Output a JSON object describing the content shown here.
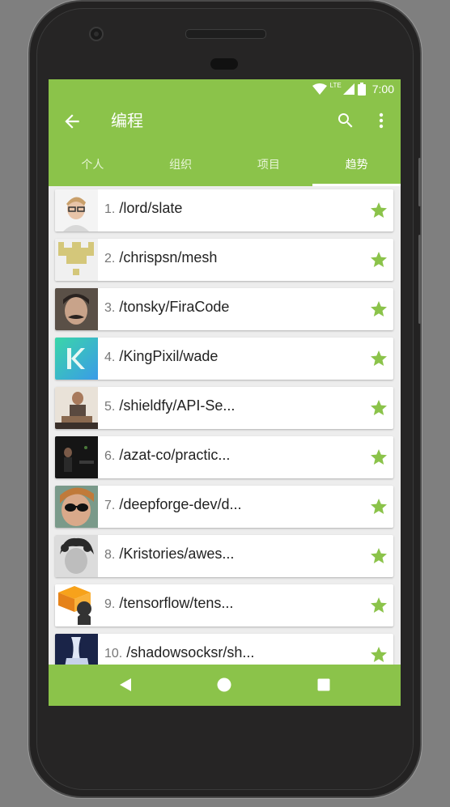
{
  "status_bar": {
    "time": "7:00",
    "network_label": "LTE"
  },
  "app_bar": {
    "title": "编程",
    "icons": [
      "back-arrow-icon",
      "search-icon",
      "more-vert-icon"
    ]
  },
  "tabs": [
    {
      "label": "个人",
      "active": false
    },
    {
      "label": "组织",
      "active": false
    },
    {
      "label": "项目",
      "active": false
    },
    {
      "label": "趋势",
      "active": true
    }
  ],
  "repos": [
    {
      "rank": "1.",
      "name": "/lord/slate"
    },
    {
      "rank": "2.",
      "name": "/chrispsn/mesh"
    },
    {
      "rank": "3.",
      "name": "/tonsky/FiraCode"
    },
    {
      "rank": "4.",
      "name": "/KingPixil/wade"
    },
    {
      "rank": "5.",
      "name": "/shieldfy/API-Se..."
    },
    {
      "rank": "6.",
      "name": "/azat-co/practic..."
    },
    {
      "rank": "7.",
      "name": "/deepforge-dev/d..."
    },
    {
      "rank": "8.",
      "name": "/Kristories/awes..."
    },
    {
      "rank": "9.",
      "name": "/tensorflow/tens..."
    },
    {
      "rank": "10.",
      "name": "/shadowsocksr/sh..."
    }
  ],
  "colors": {
    "primary": "#8bc34a",
    "star": "#8bc34a"
  }
}
